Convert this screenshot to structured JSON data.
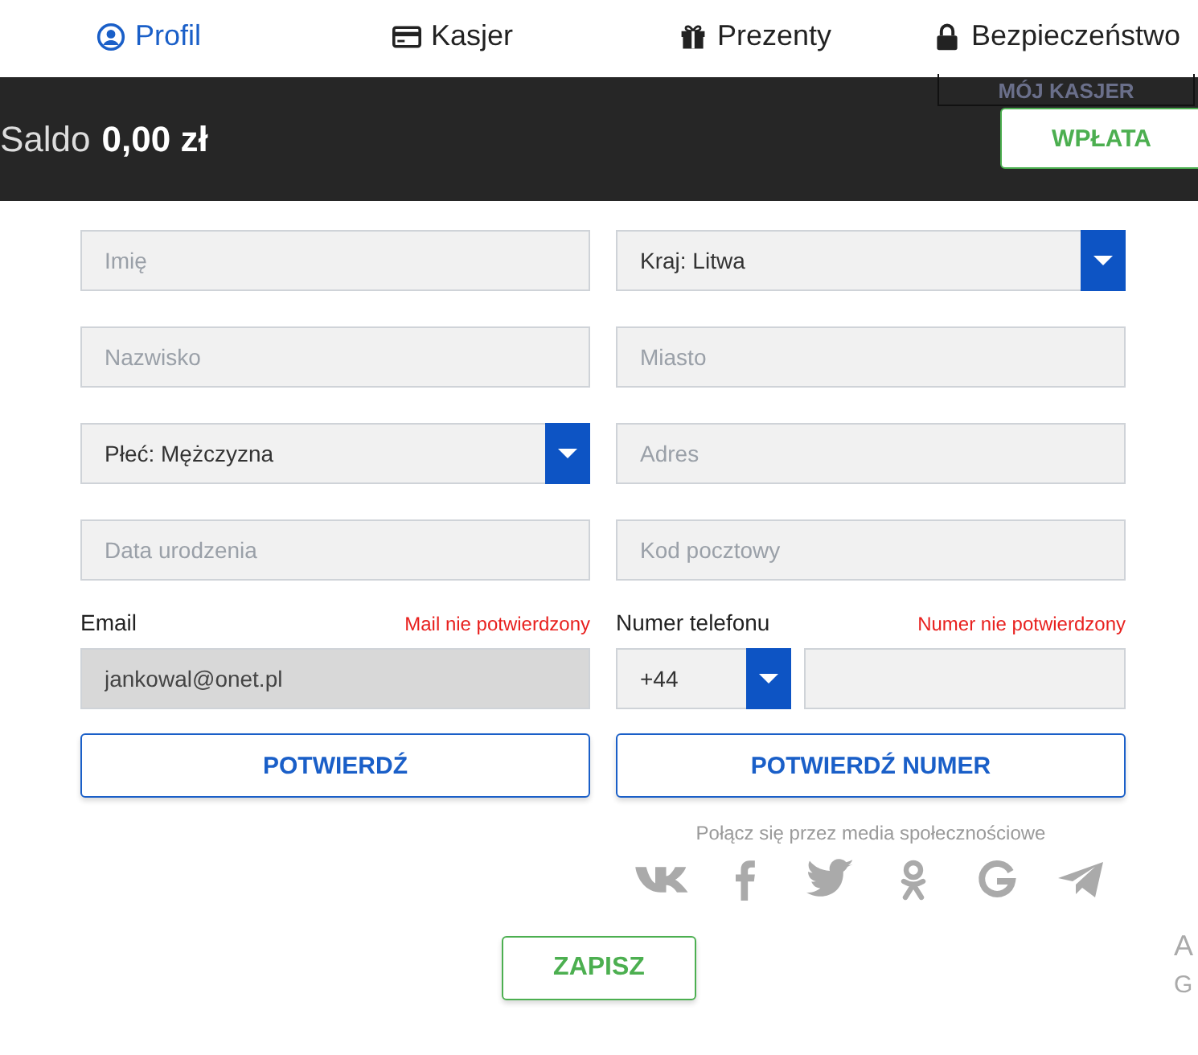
{
  "tabs": [
    {
      "label": "Profil",
      "selected": true
    },
    {
      "label": "Kasjer",
      "selected": false
    },
    {
      "label": "Prezenty",
      "selected": false
    },
    {
      "label": "Bezpieczeństwo",
      "selected": false
    }
  ],
  "balance": {
    "label": "Saldo",
    "amount": "0,00 zł",
    "cashier_button": "MÓJ KASJER",
    "deposit_button": "WPŁATA"
  },
  "form": {
    "left": [
      {
        "kind": "text",
        "placeholder": "Imię"
      },
      {
        "kind": "text",
        "placeholder": "Nazwisko"
      },
      {
        "kind": "select",
        "value": "Płeć: Mężczyzna"
      },
      {
        "kind": "text",
        "placeholder": "Data urodzenia"
      }
    ],
    "right": [
      {
        "kind": "select",
        "value": "Kraj: Litwa"
      },
      {
        "kind": "text",
        "placeholder": "Miasto"
      },
      {
        "kind": "text",
        "placeholder": "Adres"
      },
      {
        "kind": "text",
        "placeholder": "Kod pocztowy"
      }
    ],
    "email": {
      "label": "Email",
      "status": "Mail nie potwierdzony",
      "value": "jankowal@onet.pl",
      "disabled": true,
      "button": "POTWIERDŹ"
    },
    "phone": {
      "label": "Numer telefonu",
      "status": "Numer nie potwierdzony",
      "prefix": "+44",
      "button": "POTWIERDŹ NUMER"
    }
  },
  "social": {
    "label": "Połącz się przez media społecznościowe"
  },
  "save_button": "ZAPISZ",
  "edge_text": [
    "A",
    "G"
  ]
}
